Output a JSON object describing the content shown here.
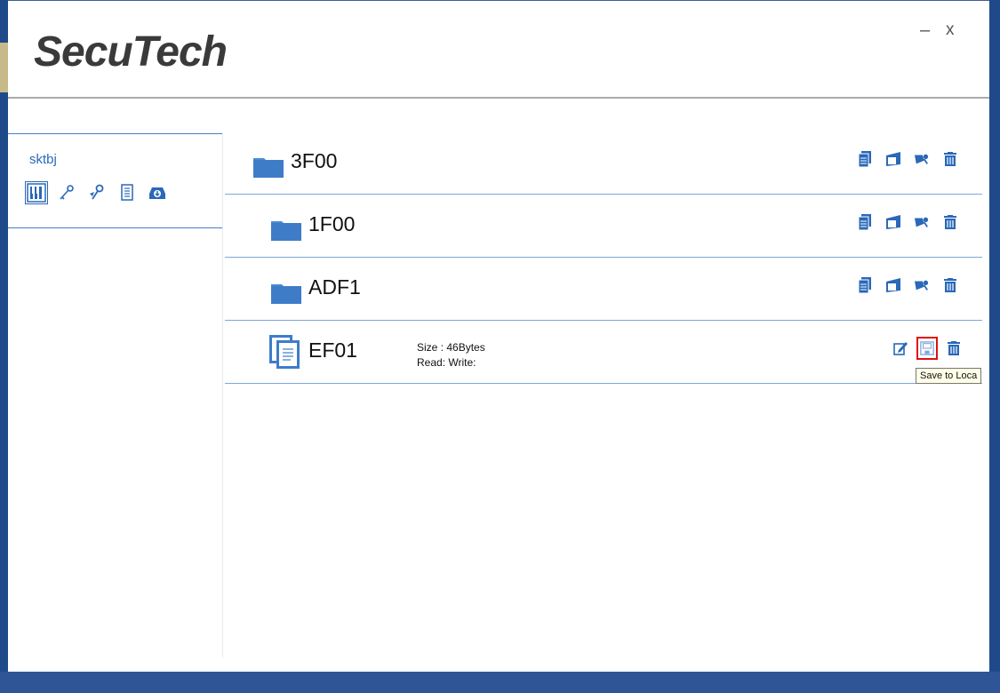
{
  "app": {
    "logo_text": "SecuTech",
    "minimize_symbol": "–",
    "close_symbol": "x",
    "accent_color": "#2f5597"
  },
  "sidebar": {
    "device_name": "sktbj",
    "tools": [
      "file-manager-icon",
      "key-icon",
      "key-access-icon",
      "document-icon",
      "download-icon"
    ]
  },
  "entries": [
    {
      "type": "folder",
      "name": "3F00",
      "actions": [
        "copy-icon",
        "new-folder-icon",
        "key-access-icon",
        "trash-icon"
      ]
    },
    {
      "type": "folder",
      "name": "1F00",
      "actions": [
        "copy-icon",
        "new-folder-icon",
        "key-access-icon",
        "trash-icon"
      ]
    },
    {
      "type": "folder",
      "name": "ADF1",
      "actions": [
        "copy-icon",
        "new-folder-icon",
        "key-access-icon",
        "trash-icon"
      ]
    },
    {
      "type": "file",
      "name": "EF01",
      "size_text": "Size : 46Bytes",
      "rw_text": "Read:  Write:",
      "actions": [
        "edit-icon",
        "save-icon",
        "trash-icon"
      ]
    }
  ],
  "tooltip": {
    "text": "Save to Loca"
  }
}
